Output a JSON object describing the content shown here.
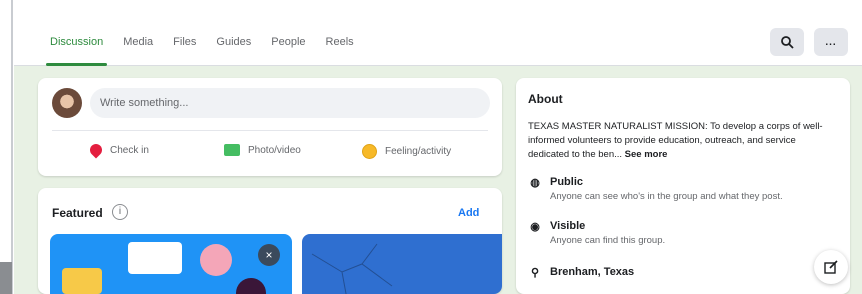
{
  "tabs": [
    {
      "label": "Discussion",
      "active": true
    },
    {
      "label": "Media",
      "active": false
    },
    {
      "label": "Files",
      "active": false
    },
    {
      "label": "Guides",
      "active": false
    },
    {
      "label": "People",
      "active": false
    },
    {
      "label": "Reels",
      "active": false
    }
  ],
  "nav_buttons": {
    "search_icon": "search-icon",
    "more_label": "..."
  },
  "composer": {
    "placeholder": "Write something...",
    "actions": [
      {
        "label": "Check in",
        "icon": "location-pin-icon"
      },
      {
        "label": "Photo/video",
        "icon": "photo-icon"
      },
      {
        "label": "Feeling/activity",
        "icon": "smiley-icon"
      }
    ]
  },
  "featured": {
    "title": "Featured",
    "add_label": "Add",
    "close_label": "×"
  },
  "about": {
    "title": "About",
    "description": "TEXAS MASTER NATURALIST MISSION: To develop a corps of well-informed volunteers to provide education, outreach, and service dedicated to the ben...",
    "see_more": "See more",
    "privacy": {
      "label": "Public",
      "sub": "Anyone can see who's in the group and what they post."
    },
    "visibility": {
      "label": "Visible",
      "sub": "Anyone can find this group."
    },
    "location": {
      "label": "Brenham, Texas"
    }
  },
  "colors": {
    "accent": "#2e8b3e",
    "link": "#1877f2",
    "background": "#e8f1e4"
  }
}
